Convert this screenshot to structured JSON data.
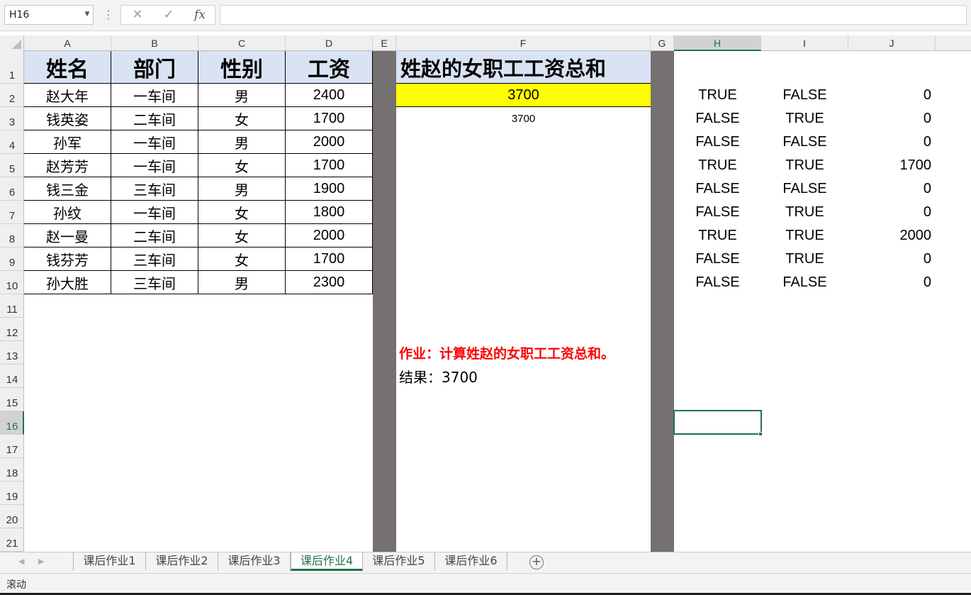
{
  "formula_bar": {
    "name_box": "H16",
    "cancel_icon": "✕",
    "enter_icon": "✓",
    "fx_label": "fx",
    "formula": ""
  },
  "columns": [
    "A",
    "B",
    "C",
    "D",
    "E",
    "F",
    "G",
    "H",
    "I",
    "J"
  ],
  "active_cell": "H16",
  "rows": [
    "1",
    "2",
    "3",
    "4",
    "5",
    "6",
    "7",
    "8",
    "9",
    "10",
    "11",
    "12",
    "13",
    "14",
    "15",
    "16",
    "17",
    "18",
    "19",
    "20",
    "21"
  ],
  "table": {
    "headers": [
      "姓名",
      "部门",
      "性别",
      "工资"
    ],
    "records": [
      [
        "赵大年",
        "一车间",
        "男",
        "2400"
      ],
      [
        "钱英姿",
        "二车间",
        "女",
        "1700"
      ],
      [
        "孙军",
        "一车间",
        "男",
        "2000"
      ],
      [
        "赵芳芳",
        "一车间",
        "女",
        "1700"
      ],
      [
        "钱三金",
        "三车间",
        "男",
        "1900"
      ],
      [
        "孙纹",
        "一车间",
        "女",
        "1800"
      ],
      [
        "赵一曼",
        "二车间",
        "女",
        "2000"
      ],
      [
        "钱芬芳",
        "三车间",
        "女",
        "1700"
      ],
      [
        "孙大胜",
        "三车间",
        "男",
        "2300"
      ]
    ]
  },
  "f_column": {
    "title": "姓赵的女职工工资总和",
    "result": "3700",
    "note_value": "3700",
    "task": "作业：计算姓赵的女职工工资总和。",
    "answer": "结果：3700"
  },
  "helper": {
    "rows": [
      [
        "TRUE",
        "FALSE",
        "0"
      ],
      [
        "FALSE",
        "TRUE",
        "0"
      ],
      [
        "FALSE",
        "FALSE",
        "0"
      ],
      [
        "TRUE",
        "TRUE",
        "1700"
      ],
      [
        "FALSE",
        "FALSE",
        "0"
      ],
      [
        "FALSE",
        "TRUE",
        "0"
      ],
      [
        "TRUE",
        "TRUE",
        "2000"
      ],
      [
        "FALSE",
        "TRUE",
        "0"
      ],
      [
        "FALSE",
        "FALSE",
        "0"
      ]
    ]
  },
  "sheet_tabs": [
    "课后作业1",
    "课后作业2",
    "课后作业3",
    "课后作业4",
    "课后作业5",
    "课后作业6"
  ],
  "active_tab": "课后作业4",
  "add_sheet_icon": "+",
  "status": "滚动",
  "colors": {
    "header_fill": "#dae3f3",
    "result_fill": "#ffff00",
    "separator_fill": "#767171",
    "task_text": "#ff0000",
    "accent": "#217346"
  }
}
